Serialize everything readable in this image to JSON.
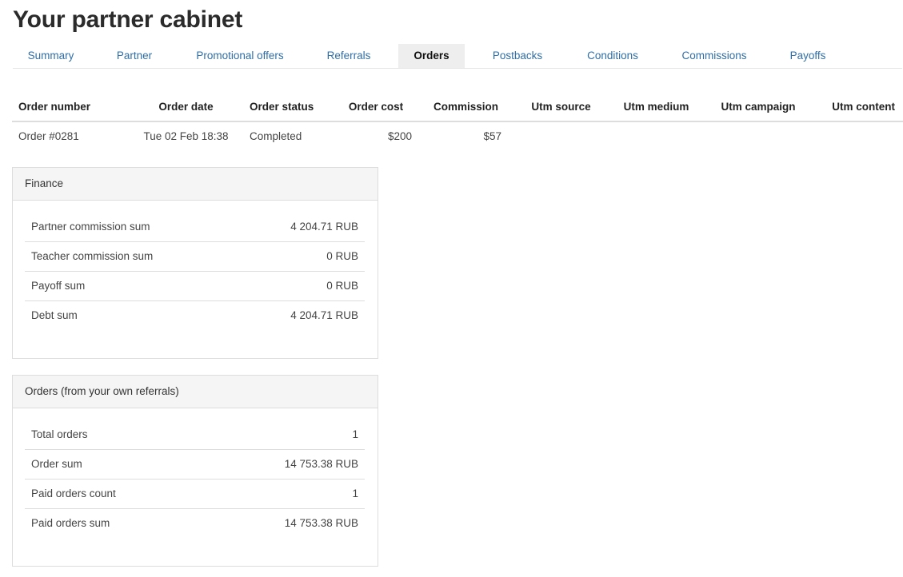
{
  "page": {
    "title": "Your partner cabinet"
  },
  "tabs": [
    {
      "label": "Summary"
    },
    {
      "label": "Partner"
    },
    {
      "label": "Promotional offers"
    },
    {
      "label": "Referrals"
    },
    {
      "label": "Orders",
      "active": true
    },
    {
      "label": "Postbacks"
    },
    {
      "label": "Conditions"
    },
    {
      "label": "Commissions"
    },
    {
      "label": "Payoffs"
    }
  ],
  "orders": {
    "columns": [
      "Order number",
      "Order date",
      "Order status",
      "Order cost",
      "Commission",
      "Utm source",
      "Utm medium",
      "Utm campaign",
      "Utm content"
    ],
    "rows": [
      {
        "number": "Order #0281",
        "date": "Tue 02 Feb 18:38",
        "status": "Completed",
        "cost": "$200",
        "commission": "$57",
        "utm_source": "",
        "utm_medium": "",
        "utm_campaign": "",
        "utm_content": ""
      }
    ]
  },
  "finance": {
    "title": "Finance",
    "rows": [
      {
        "label": "Partner commission sum",
        "value": "4 204.71 RUB"
      },
      {
        "label": "Teacher commission sum",
        "value": "0 RUB"
      },
      {
        "label": "Payoff sum",
        "value": "0 RUB"
      },
      {
        "label": "Debt sum",
        "value": "4 204.71 RUB"
      }
    ]
  },
  "referral_orders": {
    "title": "Orders (from your own referrals)",
    "rows": [
      {
        "label": "Total orders",
        "value": "1"
      },
      {
        "label": "Order sum",
        "value": "14 753.38 RUB"
      },
      {
        "label": "Paid orders count",
        "value": "1"
      },
      {
        "label": "Paid orders sum",
        "value": "14 753.38 RUB"
      }
    ]
  }
}
